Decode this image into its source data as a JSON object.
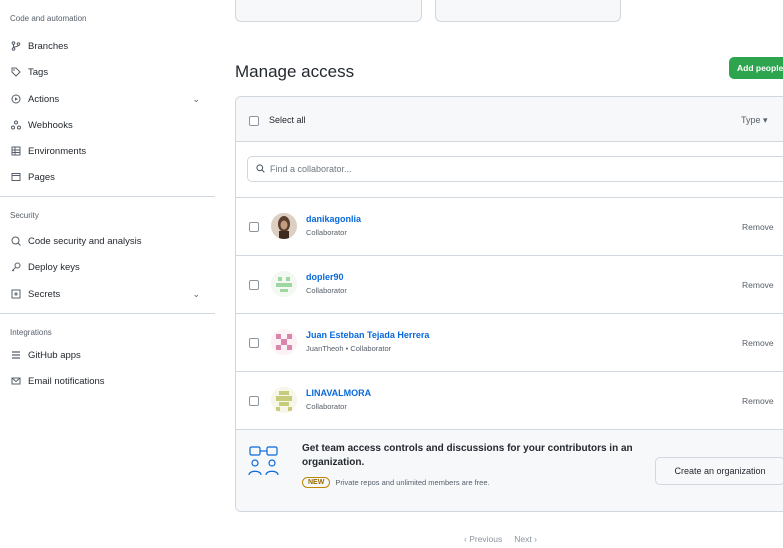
{
  "sidebar": {
    "section_code": "Code and automation",
    "items_code": [
      {
        "label": "Branches",
        "icon": "branch-icon"
      },
      {
        "label": "Tags",
        "icon": "tag-icon"
      },
      {
        "label": "Actions",
        "icon": "play-icon",
        "expandable": true
      },
      {
        "label": "Webhooks",
        "icon": "webhook-icon"
      },
      {
        "label": "Environments",
        "icon": "server-icon"
      },
      {
        "label": "Pages",
        "icon": "browser-icon"
      }
    ],
    "section_security": "Security",
    "items_security": [
      {
        "label": "Code security and analysis",
        "icon": "codescan-icon"
      },
      {
        "label": "Deploy keys",
        "icon": "key-icon"
      },
      {
        "label": "Secrets",
        "icon": "plus-square-icon",
        "expandable": true
      }
    ],
    "section_integrations": "Integrations",
    "items_integrations": [
      {
        "label": "GitHub apps",
        "icon": "apps-icon"
      },
      {
        "label": "Email notifications",
        "icon": "mail-icon"
      }
    ]
  },
  "main": {
    "title": "Manage access",
    "add_button": "Add people",
    "select_all": "Select all",
    "type_dropdown": "Type ▾",
    "filter_placeholder": "Find a collaborator...",
    "collaborators": [
      {
        "name": "danikagonlia",
        "role": "Collaborator",
        "remove": "Remove"
      },
      {
        "name": "dopler90",
        "role": "Collaborator",
        "remove": "Remove"
      },
      {
        "name": "Juan Esteban Tejada Herrera",
        "role": "JuanTheoh • Collaborator",
        "remove": "Remove"
      },
      {
        "name": "LINAVALMORA",
        "role": "Collaborator",
        "remove": "Remove"
      }
    ],
    "promo": {
      "text": "Get team access controls and discussions for your contributors in an organization.",
      "badge": "NEW",
      "sub": "Private repos and unlimited members are free.",
      "button": "Create an organization"
    },
    "pagination": {
      "prev": "‹ Previous",
      "next": "Next ›"
    }
  },
  "colors": {
    "accent_green": "#2da44e",
    "link_blue": "#0969da",
    "border": "#d0d7de"
  }
}
